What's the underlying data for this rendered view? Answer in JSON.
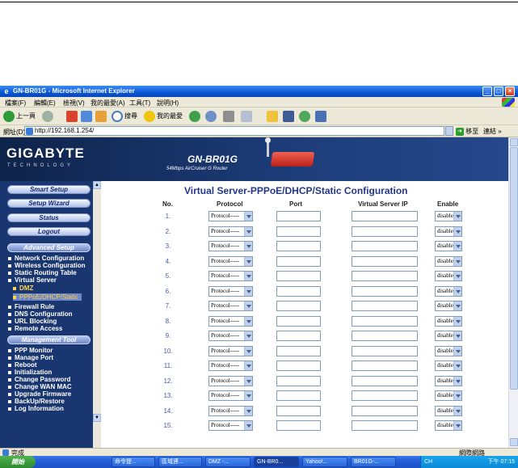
{
  "window": {
    "title": "GN-BR01G - Microsoft Internet Explorer"
  },
  "menu": [
    "檔案(F)",
    "編輯(E)",
    "檢視(V)",
    "我的最愛(A)",
    "工具(T)",
    "說明(H)"
  ],
  "toolbar": {
    "back_label": "上一頁",
    "search_label": "搜尋",
    "favorites_label": "我的最愛"
  },
  "address": {
    "label": "網址(D)",
    "url": "http://192.168.1.254/",
    "go_label": "移至",
    "links_label": "連結"
  },
  "banner": {
    "brand": "GIGABYTE",
    "brand_sub": "TECHNOLOGY",
    "model": "GN-BR01G",
    "model_sub": "54Mbps AirCruiser G Router"
  },
  "sidebar": {
    "buttons": [
      "Smart Setup",
      "Setup Wizard",
      "Status",
      "Logout"
    ],
    "advanced_title": "Advanced Setup",
    "advanced_items": [
      "Network Configuration",
      "Wireless Configuration",
      "Static Routing Table",
      "Virtual Server"
    ],
    "virtual_sub": [
      "DMZ",
      "PPPoE/DHCP/Static"
    ],
    "advanced_items2": [
      "Firewall Rule",
      "DNS Configuration",
      "URL Blocking",
      "Remote Access"
    ],
    "mgmt_title": "Management Tool",
    "mgmt_items": [
      "PPP Monitor",
      "Manage Port",
      "Reboot",
      "Initialization",
      "Change Password",
      "Change WAN MAC",
      "Upgrade Firmware",
      "BackUp/Restore",
      "Log Information"
    ]
  },
  "main": {
    "title": "Virtual Server-PPPoE/DHCP/Static Configuration",
    "headers": {
      "no": "No.",
      "protocol": "Protocol",
      "port": "Port",
      "ip": "Virtual Server IP",
      "enable": "Enable"
    },
    "rows": [
      {
        "no": "1.",
        "protocol": "Protocol-----",
        "port": "",
        "ip": "",
        "enable": "disable"
      },
      {
        "no": "2.",
        "protocol": "Protocol-----",
        "port": "",
        "ip": "",
        "enable": "disable"
      },
      {
        "no": "3.",
        "protocol": "Protocol-----",
        "port": "",
        "ip": "",
        "enable": "disable"
      },
      {
        "no": "4.",
        "protocol": "Protocol-----",
        "port": "",
        "ip": "",
        "enable": "disable"
      },
      {
        "no": "5.",
        "protocol": "Protocol-----",
        "port": "",
        "ip": "",
        "enable": "disable"
      },
      {
        "no": "6.",
        "protocol": "Protocol-----",
        "port": "",
        "ip": "",
        "enable": "disable"
      },
      {
        "no": "7.",
        "protocol": "Protocol-----",
        "port": "",
        "ip": "",
        "enable": "disable"
      },
      {
        "no": "8.",
        "protocol": "Protocol-----",
        "port": "",
        "ip": "",
        "enable": "disable"
      },
      {
        "no": "9.",
        "protocol": "Protocol-----",
        "port": "",
        "ip": "",
        "enable": "disable"
      },
      {
        "no": "10.",
        "protocol": "Protocol-----",
        "port": "",
        "ip": "",
        "enable": "disable"
      },
      {
        "no": "11.",
        "protocol": "Protocol-----",
        "port": "",
        "ip": "",
        "enable": "disable"
      },
      {
        "no": "12.",
        "protocol": "Protocol-----",
        "port": "",
        "ip": "",
        "enable": "disable"
      },
      {
        "no": "13.",
        "protocol": "Protocol-----",
        "port": "",
        "ip": "",
        "enable": "disable"
      },
      {
        "no": "14.",
        "protocol": "Protocol-----",
        "port": "",
        "ip": "",
        "enable": "disable"
      },
      {
        "no": "15.",
        "protocol": "Protocol-----",
        "port": "",
        "ip": "",
        "enable": "disable"
      }
    ]
  },
  "status": {
    "text": "完成",
    "zone": "網際網路"
  },
  "taskbar": {
    "start": "開始",
    "tasks": [
      "命令提...",
      "區域連...",
      "DMZ -...",
      "GN-BR0...",
      "Yahoo!...",
      "BR01G-..."
    ],
    "tray_lang": "CH",
    "clock": "下午 07:15"
  },
  "colors": {
    "nav_bg": "#1a3670",
    "title_blue": "#23378a",
    "row_number": "#4759b0",
    "active_sub": "#ffd24a"
  }
}
